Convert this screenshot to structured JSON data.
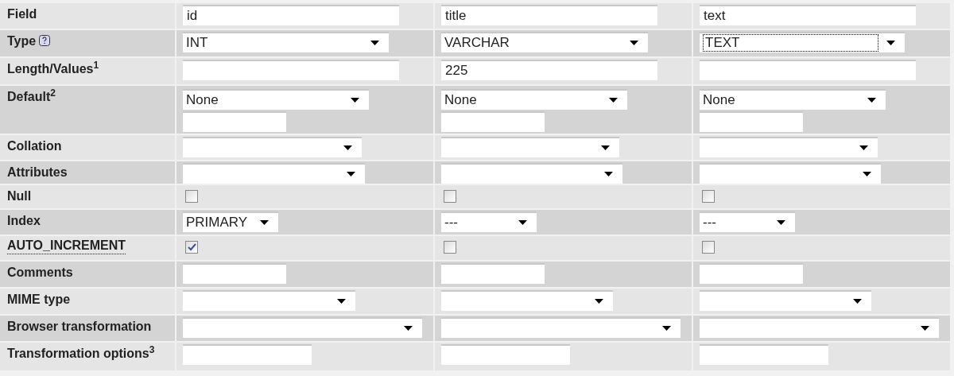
{
  "rows": [
    {
      "label": "Field",
      "help": false,
      "abbr": false,
      "kind": "text",
      "cells": [
        {
          "value": "id"
        },
        {
          "value": "title"
        },
        {
          "value": "text"
        }
      ]
    },
    {
      "label": "Type",
      "help": true,
      "abbr": false,
      "kind": "select",
      "cells": [
        {
          "value": "INT",
          "focused": false
        },
        {
          "value": "VARCHAR",
          "focused": false
        },
        {
          "value": "TEXT",
          "focused": true
        }
      ]
    },
    {
      "label": "Length/Values$^{1}$",
      "help": false,
      "abbr": false,
      "kind": "text",
      "cells": [
        {},
        {
          "value": "225"
        },
        {}
      ]
    },
    {
      "label": "Default$^{2}$",
      "help": false,
      "abbr": false,
      "kind": "default",
      "cells": [
        {
          "value": "None"
        },
        {
          "value": "None"
        },
        {
          "value": "None"
        }
      ]
    },
    {
      "label": "Collation",
      "help": false,
      "abbr": false,
      "kind": "select",
      "cells": [
        {
          "focused": false
        },
        {
          "focused": false
        },
        {
          "focused": false
        }
      ]
    },
    {
      "label": "Attributes",
      "help": false,
      "abbr": false,
      "kind": "select",
      "cells": [
        {
          "focused": false
        },
        {
          "focused": false
        },
        {
          "focused": false
        }
      ]
    },
    {
      "label": "Null",
      "help": false,
      "abbr": false,
      "kind": "checkbox",
      "cells": [
        {
          "checked": false
        },
        {
          "checked": false
        },
        {
          "checked": false
        }
      ]
    },
    {
      "label": "Index",
      "help": false,
      "abbr": false,
      "kind": "select",
      "cells": [
        {
          "value": "PRIMARY",
          "focused": false
        },
        {
          "value": "---",
          "focused": false
        },
        {
          "value": "---",
          "focused": false
        }
      ]
    },
    {
      "label": "AUTO_INCREMENT",
      "help": false,
      "abbr": true,
      "kind": "checkbox",
      "cells": [
        {
          "checked": true
        },
        {
          "checked": false
        },
        {
          "checked": false
        }
      ]
    },
    {
      "label": "Comments",
      "help": false,
      "abbr": false,
      "kind": "text",
      "cells": [
        {},
        {},
        {}
      ]
    },
    {
      "label": "MIME type",
      "help": false,
      "abbr": false,
      "kind": "select",
      "cells": [
        {
          "focused": false
        },
        {
          "focused": false
        },
        {
          "focused": false
        }
      ]
    },
    {
      "label": "Browser transformation",
      "help": false,
      "abbr": false,
      "kind": "select",
      "cells": [
        {
          "focused": false
        },
        {
          "focused": false
        },
        {
          "focused": false
        }
      ]
    },
    {
      "label": "Transformation options$^{3}$",
      "help": false,
      "abbr": false,
      "kind": "text",
      "cells": [
        {},
        {},
        {}
      ]
    }
  ]
}
